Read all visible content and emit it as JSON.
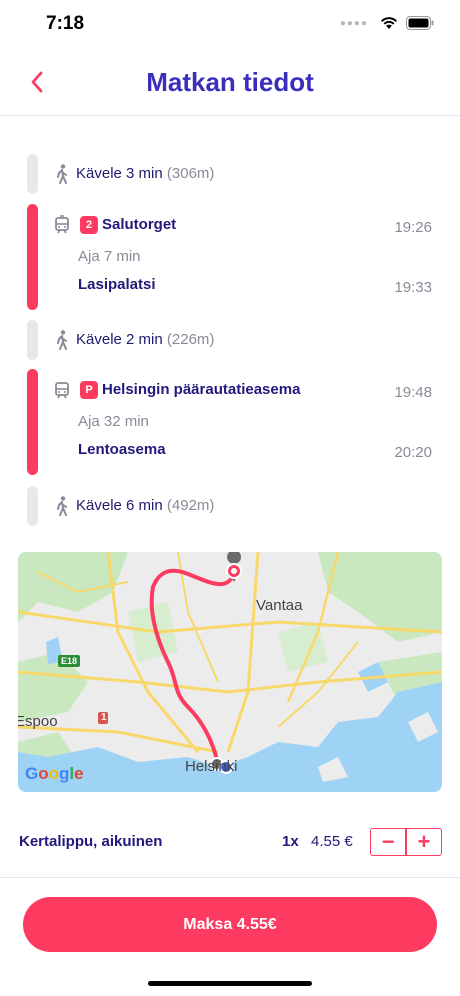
{
  "status_bar": {
    "time": "7:18"
  },
  "header": {
    "title": "Matkan tiedot"
  },
  "legs": [
    {
      "type": "walk",
      "text": "Kävele 3 min",
      "distance": "(306m)"
    },
    {
      "type": "ride",
      "badge": "2",
      "from": "Salutorget",
      "from_time": "19:26",
      "duration": "Aja 7 min",
      "to": "Lasipalatsi",
      "to_time": "19:33"
    },
    {
      "type": "walk",
      "text": "Kävele 2 min",
      "distance": "(226m)"
    },
    {
      "type": "ride",
      "badge": "P",
      "from": "Helsingin päärautatieasema",
      "from_time": "19:48",
      "duration": "Aja 32 min",
      "to": "Lentoasema",
      "to_time": "20:20"
    },
    {
      "type": "walk",
      "text": "Kävele 6 min",
      "distance": "(492m)"
    }
  ],
  "map": {
    "labels": {
      "vantaa": "Vantaa",
      "espoo": "Espoo",
      "helsinki": "Helsinki",
      "e18": "E18",
      "road_1": "1"
    },
    "google": "Google",
    "colors": {
      "route": "#fd3b60",
      "water": "#9ed3f6",
      "land": "#ececec",
      "park": "#c9e8c0",
      "road": "#f9d86a"
    }
  },
  "ticket": {
    "name": "Kertalippu, aikuinen",
    "quantity": "1x",
    "price": "4.55 €",
    "minus": "−",
    "plus": "+"
  },
  "pay_button": {
    "label": "Maksa 4.55€"
  },
  "colors": {
    "accent": "#fd3b60",
    "title": "#3a2fbc",
    "text": "#22197a"
  }
}
